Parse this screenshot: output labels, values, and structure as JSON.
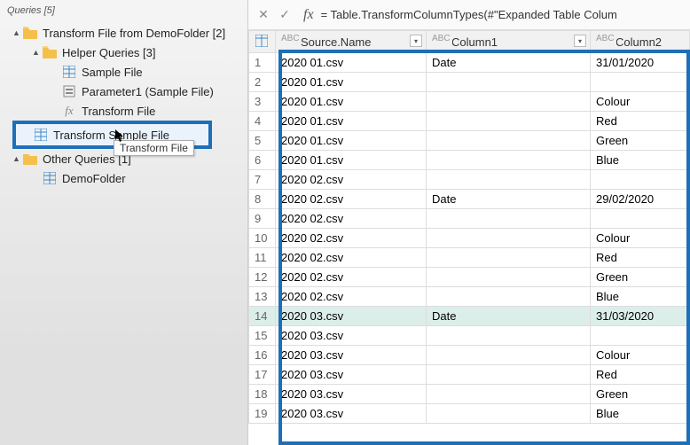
{
  "sidebar": {
    "header": "Queries [5]",
    "root": {
      "label": "Transform File from DemoFolder [2]",
      "helper_label": "Helper Queries [3]",
      "items": [
        {
          "label": "Sample File"
        },
        {
          "label": "Parameter1 (Sample File)"
        },
        {
          "label": "Transform File"
        }
      ],
      "selected_label": "Transform Sample File",
      "tooltip": "Transform File",
      "other_label": "Other Queries [1]",
      "demo_label": "DemoFolder"
    }
  },
  "formula": "= Table.TransformColumnTypes(#\"Expanded Table Colum",
  "table": {
    "col1": "Source.Name",
    "col2": "Column1",
    "col3": "Column2",
    "type_label": "ABC",
    "rows": [
      {
        "n": 1,
        "src": "2020 01.csv",
        "c1": "Date",
        "c2": "31/01/2020",
        "sel": false
      },
      {
        "n": 2,
        "src": "2020 01.csv",
        "c1": "",
        "c2": "",
        "sel": false
      },
      {
        "n": 3,
        "src": "2020 01.csv",
        "c1": "",
        "c2": "Colour",
        "sel": false
      },
      {
        "n": 4,
        "src": "2020 01.csv",
        "c1": "",
        "c2": "Red",
        "sel": false
      },
      {
        "n": 5,
        "src": "2020 01.csv",
        "c1": "",
        "c2": "Green",
        "sel": false
      },
      {
        "n": 6,
        "src": "2020 01.csv",
        "c1": "",
        "c2": "Blue",
        "sel": false
      },
      {
        "n": 7,
        "src": "2020 02.csv",
        "c1": "",
        "c2": "",
        "sel": false
      },
      {
        "n": 8,
        "src": "2020 02.csv",
        "c1": "Date",
        "c2": "29/02/2020",
        "sel": false
      },
      {
        "n": 9,
        "src": "2020 02.csv",
        "c1": "",
        "c2": "",
        "sel": false
      },
      {
        "n": 10,
        "src": "2020 02.csv",
        "c1": "",
        "c2": "Colour",
        "sel": false
      },
      {
        "n": 11,
        "src": "2020 02.csv",
        "c1": "",
        "c2": "Red",
        "sel": false
      },
      {
        "n": 12,
        "src": "2020 02.csv",
        "c1": "",
        "c2": "Green",
        "sel": false
      },
      {
        "n": 13,
        "src": "2020 02.csv",
        "c1": "",
        "c2": "Blue",
        "sel": false
      },
      {
        "n": 14,
        "src": "2020 03.csv",
        "c1": "Date",
        "c2": "31/03/2020",
        "sel": true
      },
      {
        "n": 15,
        "src": "2020 03.csv",
        "c1": "",
        "c2": "",
        "sel": false
      },
      {
        "n": 16,
        "src": "2020 03.csv",
        "c1": "",
        "c2": "Colour",
        "sel": false
      },
      {
        "n": 17,
        "src": "2020 03.csv",
        "c1": "",
        "c2": "Red",
        "sel": false
      },
      {
        "n": 18,
        "src": "2020 03.csv",
        "c1": "",
        "c2": "Green",
        "sel": false
      },
      {
        "n": 19,
        "src": "2020 03.csv",
        "c1": "",
        "c2": "Blue",
        "sel": false
      }
    ]
  }
}
